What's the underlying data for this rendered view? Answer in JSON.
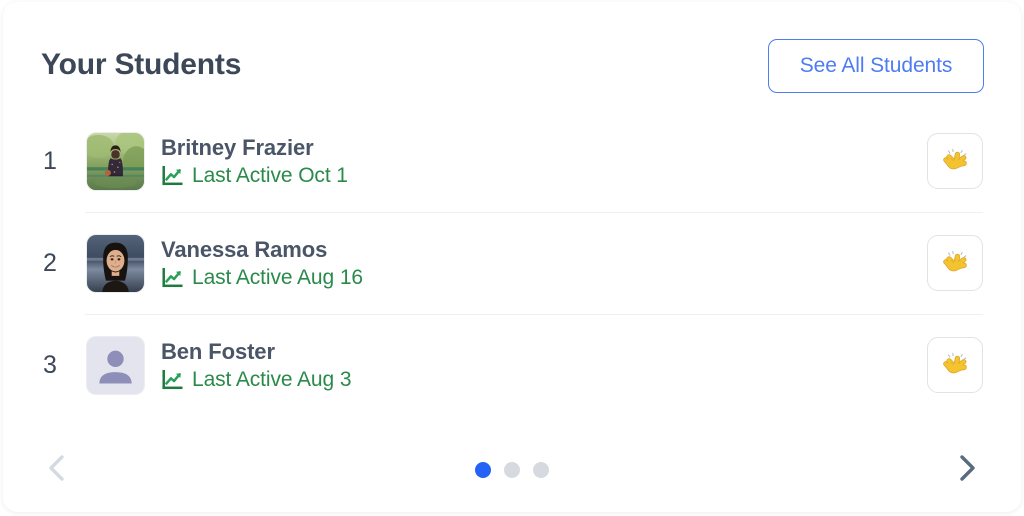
{
  "header": {
    "title": "Your Students",
    "see_all_label": "See All Students"
  },
  "students": [
    {
      "rank": "1",
      "name": "Britney Frazier",
      "last_active": "Last Active Oct 1",
      "avatar_type": "photo-garden-bridge",
      "action_icon": "clapping-hands-emoji"
    },
    {
      "rank": "2",
      "name": "Vanessa Ramos",
      "last_active": "Last Active Aug 16",
      "avatar_type": "photo-portrait-dark",
      "action_icon": "clapping-hands-emoji"
    },
    {
      "rank": "3",
      "name": "Ben Foster",
      "last_active": "Last Active Aug 3",
      "avatar_type": "placeholder-person",
      "action_icon": "clapping-hands-emoji"
    }
  ],
  "carousel": {
    "prev_icon": "chevron-left-icon",
    "next_icon": "chevron-right-icon",
    "total_pages": 3,
    "active_page": 1
  },
  "colors": {
    "accent_blue": "#4d7cf3",
    "dot_active": "#2563f5",
    "dot_inactive": "#d6dae0",
    "status_green": "#2a8a4a",
    "title_slate": "#3c4858",
    "arrow_disabled": "#d4dae1",
    "arrow_active": "#5a6b7d"
  }
}
